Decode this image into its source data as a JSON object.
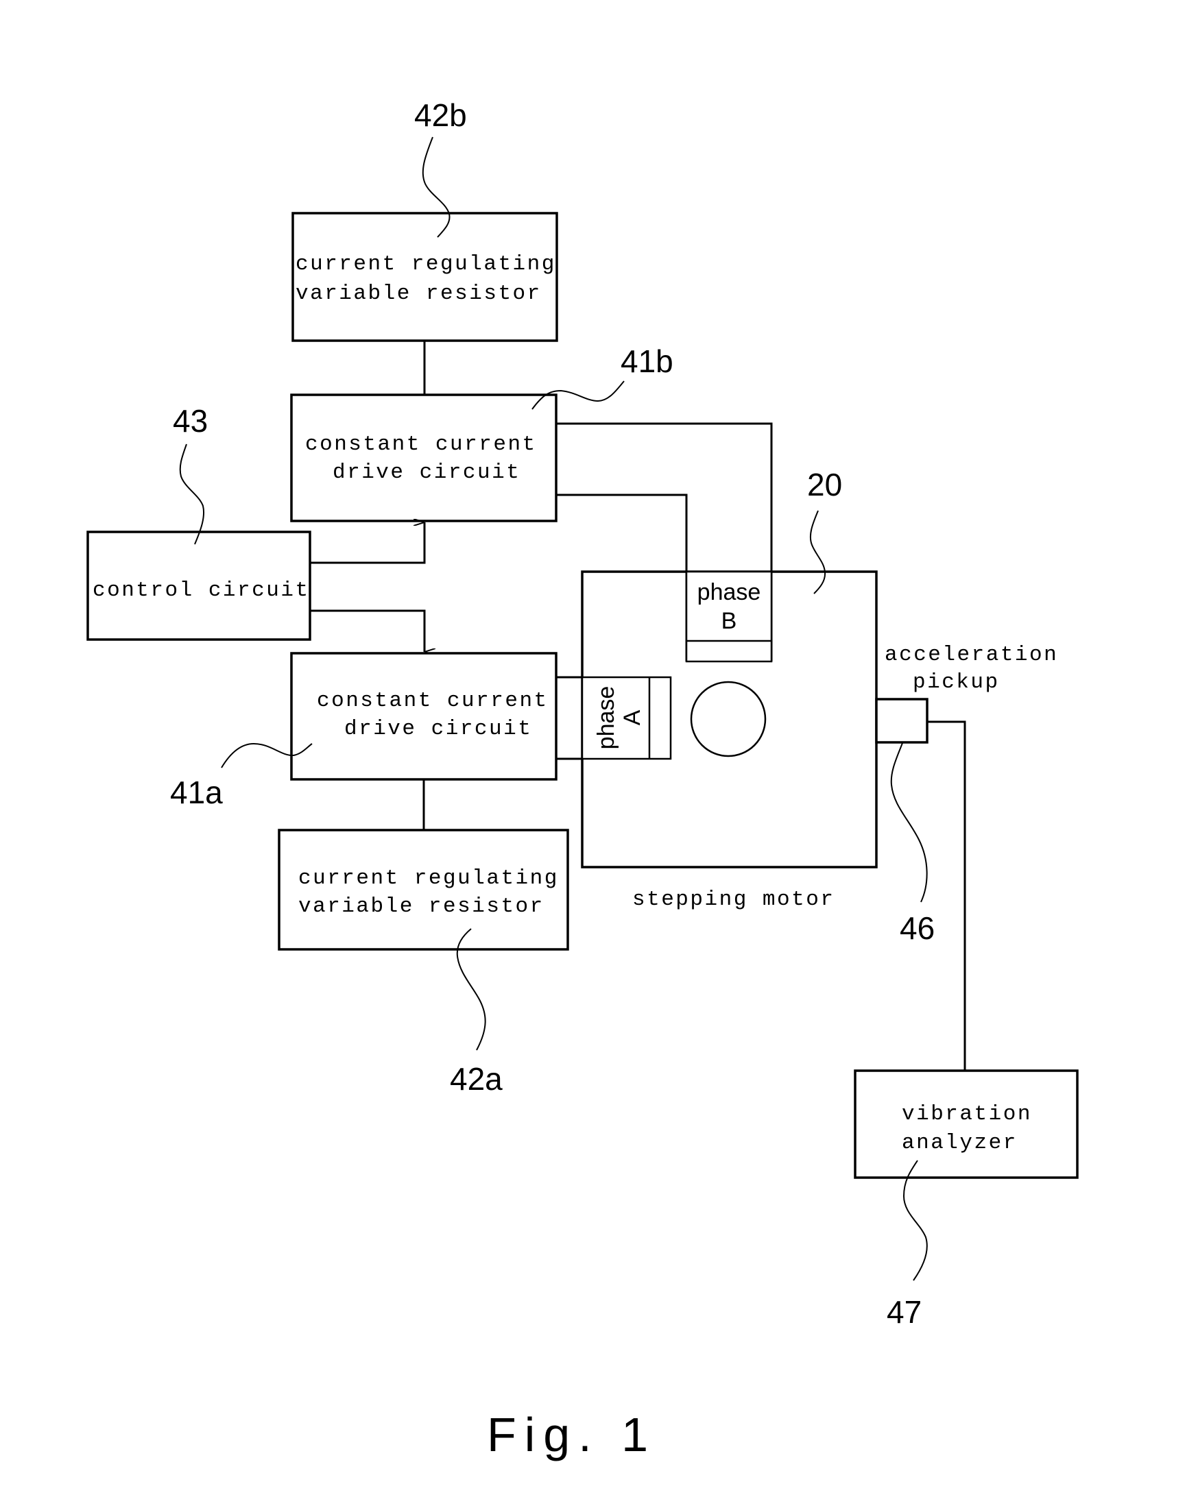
{
  "figure": {
    "caption": "Fig. 1",
    "blocks": {
      "resistor_b": {
        "ref": "42b",
        "line1": "current regulating",
        "line2": "variable resistor"
      },
      "drive_b": {
        "ref": "41b",
        "line1": "constant current",
        "line2": "drive circuit"
      },
      "control": {
        "ref": "43",
        "line1": "control circuit"
      },
      "drive_a": {
        "ref": "41a",
        "line1": "constant current",
        "line2": "drive circuit"
      },
      "resistor_a": {
        "ref": "42a",
        "line1": "current regulating",
        "line2": "variable resistor"
      },
      "motor": {
        "ref": "20",
        "label": "stepping motor"
      },
      "phase_b": {
        "line1": "phase",
        "line2": "B"
      },
      "phase_a": {
        "line1": "phase",
        "line2": "A"
      },
      "pickup": {
        "ref": "46",
        "line1": "acceleration",
        "line2": "pickup"
      },
      "analyzer": {
        "ref": "47",
        "line1": "vibration",
        "line2": "analyzer"
      }
    }
  }
}
